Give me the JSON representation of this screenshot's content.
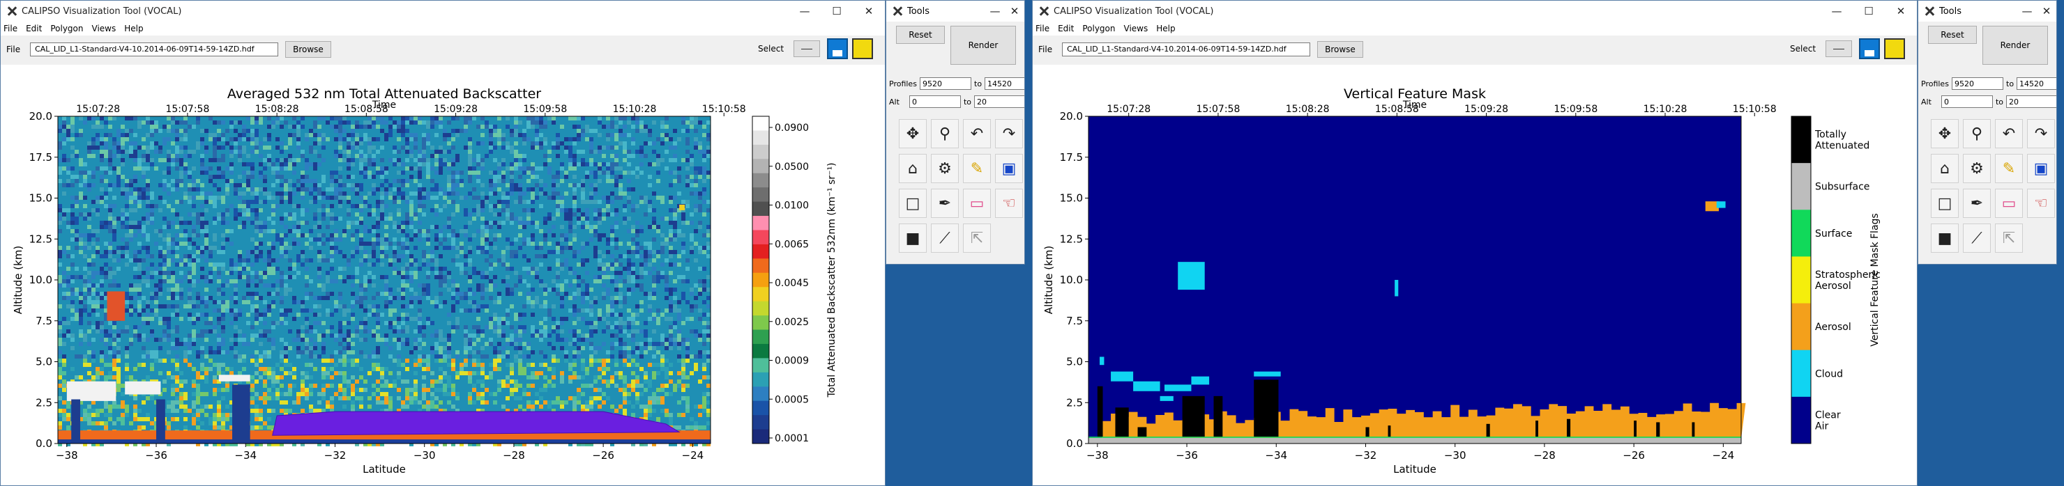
{
  "app": {
    "title": "CALIPSO Visualization Tool (VOCAL)",
    "menu": [
      "File",
      "Edit",
      "Polygon",
      "Views",
      "Help"
    ],
    "file_label": "File",
    "browse_label": "Browse",
    "select_label": "Select",
    "controls": {
      "minimize": "—",
      "maximize": "☐",
      "close": "✕"
    }
  },
  "windows": [
    {
      "filename": "CAL_LID_L1-Standard-V4-10.2014-06-09T14-59-14ZD.hdf",
      "plot": {
        "title": "Averaged 532 nm Total Attenuated Backscatter",
        "time_label": "Time",
        "xlabel": "Latitude",
        "ylabel": "Altitude (km)",
        "colorbar_label": "Total Attenuated Backscatter 532nm (km⁻¹ sr⁻¹)"
      }
    },
    {
      "filename": "CAL_LID_L1-Standard-V4-10.2014-06-09T14-59-14ZD.hdf",
      "plot": {
        "title": "Vertical Feature Mask",
        "time_label": "Time",
        "xlabel": "Latitude",
        "ylabel": "Altitude (km)",
        "colorbar_label": "Vertical Feature Mask Flags"
      }
    }
  ],
  "tools": {
    "title": "Tools",
    "reset_label": "Reset",
    "render_label": "Render",
    "profiles_label": "Profiles",
    "alt_label": "Alt",
    "to_label": "to",
    "profiles_from": "9520",
    "profiles_to": "14520",
    "alt_from": "0",
    "alt_to": "20",
    "icons": [
      "move-icon",
      "zoom-icon",
      "undo-icon",
      "redo-icon",
      "home-icon",
      "settings-icon",
      "edit-icon",
      "image-icon",
      "rectangle-icon",
      "pen-icon",
      "eraser-icon",
      "hand-icon",
      "color-picker-icon",
      "chart-icon",
      "select-icon"
    ]
  },
  "chart_data": [
    {
      "type": "heatmap",
      "title": "Averaged 532 nm Total Attenuated Backscatter",
      "xlabel": "Latitude",
      "ylabel": "Altitude (km)",
      "x_ticks": [
        -38,
        -36,
        -34,
        -32,
        -30,
        -28,
        -26,
        -24
      ],
      "y_ticks": [
        "0.0",
        "2.5",
        "5.0",
        "7.5",
        "10.0",
        "12.5",
        "15.0",
        "17.5",
        "20.0"
      ],
      "top_axis_label": "Time",
      "time_ticks": [
        "15:07:28",
        "15:07:58",
        "15:08:28",
        "15:08:58",
        "15:09:28",
        "15:09:58",
        "15:10:28",
        "15:10:58"
      ],
      "xlim": [
        -38.2,
        -23.6
      ],
      "ylim": [
        0,
        20
      ],
      "colorbar_ticks": [
        "0.0900",
        "0.0500",
        "0.0100",
        "0.0065",
        "0.0045",
        "0.0025",
        "0.0009",
        "0.0005",
        "0.0001"
      ],
      "colorbar_label": "Total Attenuated Backscatter 532nm (km⁻¹ sr⁻¹)"
    },
    {
      "type": "heatmap",
      "title": "Vertical Feature Mask",
      "xlabel": "Latitude",
      "ylabel": "Altitude (km)",
      "x_ticks": [
        -38,
        -36,
        -34,
        -32,
        -30,
        -28,
        -26,
        -24
      ],
      "y_ticks": [
        "0.0",
        "2.5",
        "5.0",
        "7.5",
        "10.0",
        "12.5",
        "15.0",
        "17.5",
        "20.0"
      ],
      "top_axis_label": "Time",
      "time_ticks": [
        "15:07:28",
        "15:07:58",
        "15:08:28",
        "15:08:58",
        "15:09:28",
        "15:09:58",
        "15:10:28",
        "15:10:58"
      ],
      "xlim": [
        -38.2,
        -23.6
      ],
      "ylim": [
        0,
        20
      ],
      "categories": [
        "Totally Attenuated",
        "Subsurface",
        "Surface",
        "Stratospheric Aerosol",
        "Aerosol",
        "Cloud",
        "Clear Air"
      ],
      "category_colors": [
        "#000000",
        "#bdbdbd",
        "#11d95a",
        "#f5ee0c",
        "#f4a01b",
        "#10d4f2",
        "#00008b"
      ],
      "colorbar_label": "Vertical Feature Mask Flags"
    }
  ]
}
